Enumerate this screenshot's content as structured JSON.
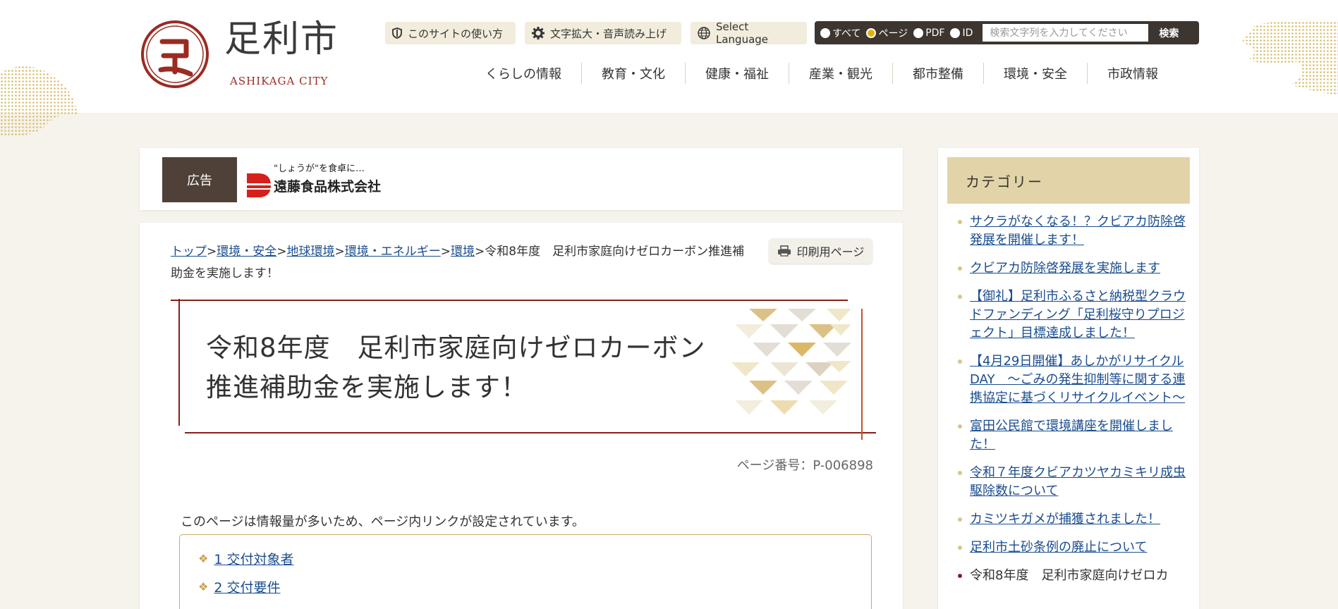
{
  "header": {
    "logo_name": "足利市",
    "logo_en": "ASHIKAGA CITY",
    "utility": {
      "howto": "このサイトの使い方",
      "zoom_audio": "文字拡大・音声読み上げ",
      "language": "Select Language"
    },
    "search": {
      "options": [
        "すべて",
        "ページ",
        "PDF",
        "ID"
      ],
      "selected": "ページ",
      "placeholder": "検索文字列を入力してください",
      "button": "検索"
    },
    "nav": [
      "くらしの情報",
      "教育・文化",
      "健康・福祉",
      "産業・観光",
      "都市整備",
      "環境・安全",
      "市政情報"
    ]
  },
  "ad": {
    "label": "広告",
    "slogan": "\"しょうが\"を食卓に…",
    "company": "遠藤食品株式会社"
  },
  "breadcrumb": {
    "links": [
      "トップ",
      "環境・安全",
      "地球環境",
      "環境・エネルギー",
      "環境"
    ],
    "separator": ">",
    "current": "令和8年度　足利市家庭向けゼロカーボン推進補助金を実施します！"
  },
  "print_label": "印刷用ページ",
  "page_title_line1": "令和8年度　足利市家庭向けゼロカーボン",
  "page_title_line2": "推進補助金を実施します！",
  "page_number": "ページ番号：P-006898",
  "intro": "このページは情報量が多いため、ページ内リンクが設定されています。",
  "toc": [
    "1  交付対象者",
    "2  交付要件"
  ],
  "sidebar": {
    "title": "カテゴリー",
    "items": [
      "サクラがなくなる！？クビアカ防除啓発展を開催します！",
      "クビアカ防除啓発展を実施します",
      "【御礼】足利市ふるさと納税型クラウドファンディング「足利桜守りプロジェクト」目標達成しました！",
      "【4月29日開催】あしかがリサイクルDAY　～ごみの発生抑制等に関する連携協定に基づくリサイクルイベント～",
      "富田公民館で環境講座を開催しました！",
      "令和７年度クビアカツヤカミキリ成虫駆除数について",
      "カミツキガメが捕獲されました！",
      "足利市土砂条例の廃止について",
      "令和8年度　足利市家庭向けゼロカ"
    ]
  },
  "colors": {
    "brand_red": "#9a2b22",
    "link": "#1a4d8f",
    "accent_gold": "#c8aa63",
    "dark_brown": "#3c3530"
  }
}
